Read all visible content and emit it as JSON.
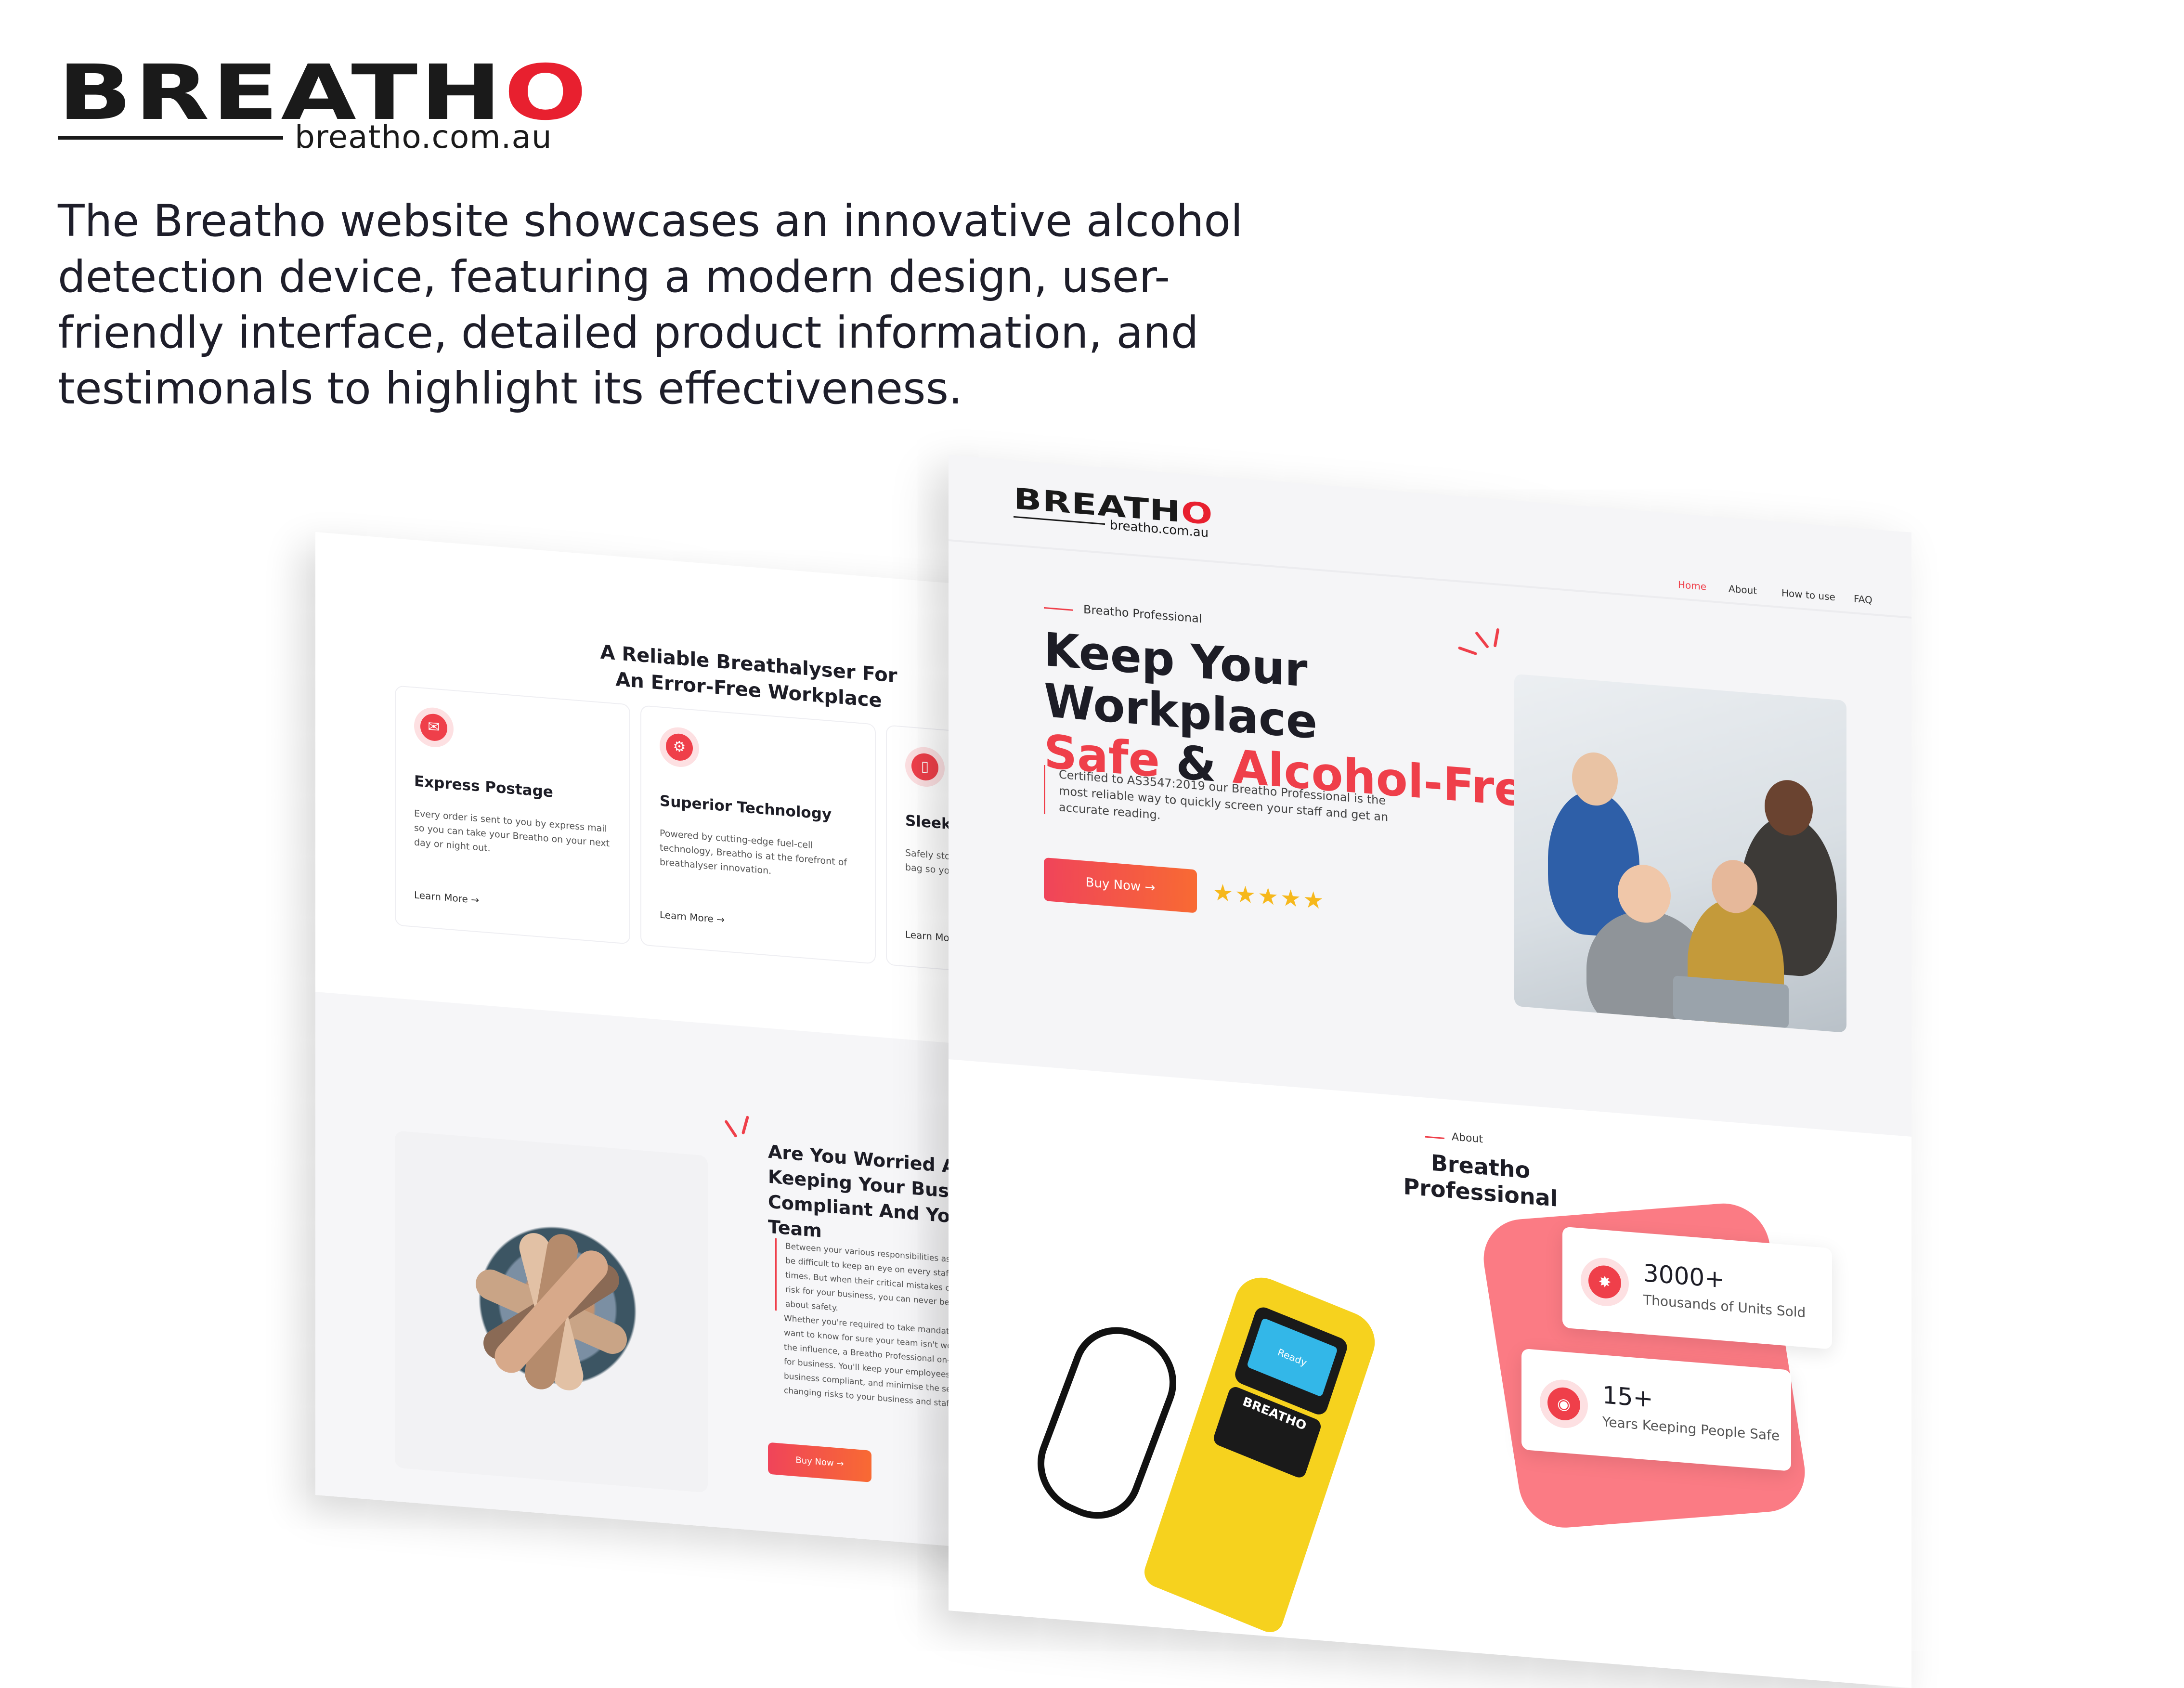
{
  "logo": {
    "word": "BREATH",
    "word_o": "O",
    "url": "breatho.com.au"
  },
  "intro": "The Breatho website showcases an innovative alcohol detection device, featuring a modern design, user-friendly interface, detailed product information, and testimonals to highlight its effectiveness.",
  "colors": {
    "accent": "#ef3f4a",
    "accent_orange": "#f86a33",
    "dark": "#1d1d26",
    "star": "#f6b81c",
    "blob": "#fb7b84"
  },
  "left_page": {
    "title": "A Reliable Breathalyser For An Error-Free Workplace",
    "cards": [
      {
        "icon": "envelope-icon",
        "title": "Express Postage",
        "desc": "Every order is sent to you by express mail so you can take your Breatho on your next day or night out.",
        "link": "Learn More →"
      },
      {
        "icon": "chip-icon",
        "title": "Superior Technology",
        "desc": "Powered by cutting-edge fuel-cell technology, Breatho is at the forefront of breathalyser innovation.",
        "link": "Learn More →"
      },
      {
        "icon": "phone-icon",
        "title": "Sleek Portable",
        "desc": "Safely store your Breatho in your pocket or bag so you can test whenever you need to.",
        "link": "Learn More →"
      }
    ],
    "section_title": "Are You Worried About Keeping Your Business Compliant And Your Team",
    "para1": "Between your various responsibilities as a leader, it can be difficult to keep an eye on every staff member at all times. But when their critical mistakes can be a huge risk for your business, you can never be too careful about safety.",
    "para2": "Whether you're required to take mandatory tests or just want to know for sure your team isn't working under the influence, a Breatho Professional on-hand is good for business. You'll keep your employees safe, your business compliant, and minimise the serious, life-changing risks to your business and staff.",
    "button": "Buy Now →"
  },
  "right_page": {
    "logo": {
      "word": "BREATH",
      "word_o": "O",
      "url": "breatho.com.au"
    },
    "nav": [
      "Home",
      "About",
      "How to use",
      "FAQ"
    ],
    "eyebrow": "Breatho Professional",
    "headline_1": "Keep Your",
    "headline_2": "Workplace",
    "headline_safe": "Safe",
    "headline_amp": " & ",
    "headline_alcohol": "Alcohol-Free",
    "description": "Certified to AS3547:2019 our Breatho Professional is the most reliable way to quickly screen your staff and get an accurate reading.",
    "button": "Buy Now →",
    "rating": 5,
    "stars": "★★★★★",
    "about_tag": "About",
    "about_title": "Breatho Professional",
    "device_screen": "Ready",
    "device_brand": "BREATHO",
    "stats": [
      {
        "icon": "flame-icon",
        "value": "3000+",
        "label": "Thousands of Units Sold"
      },
      {
        "icon": "signal-icon",
        "value": "15+",
        "label": "Years Keeping People Safe"
      }
    ]
  }
}
